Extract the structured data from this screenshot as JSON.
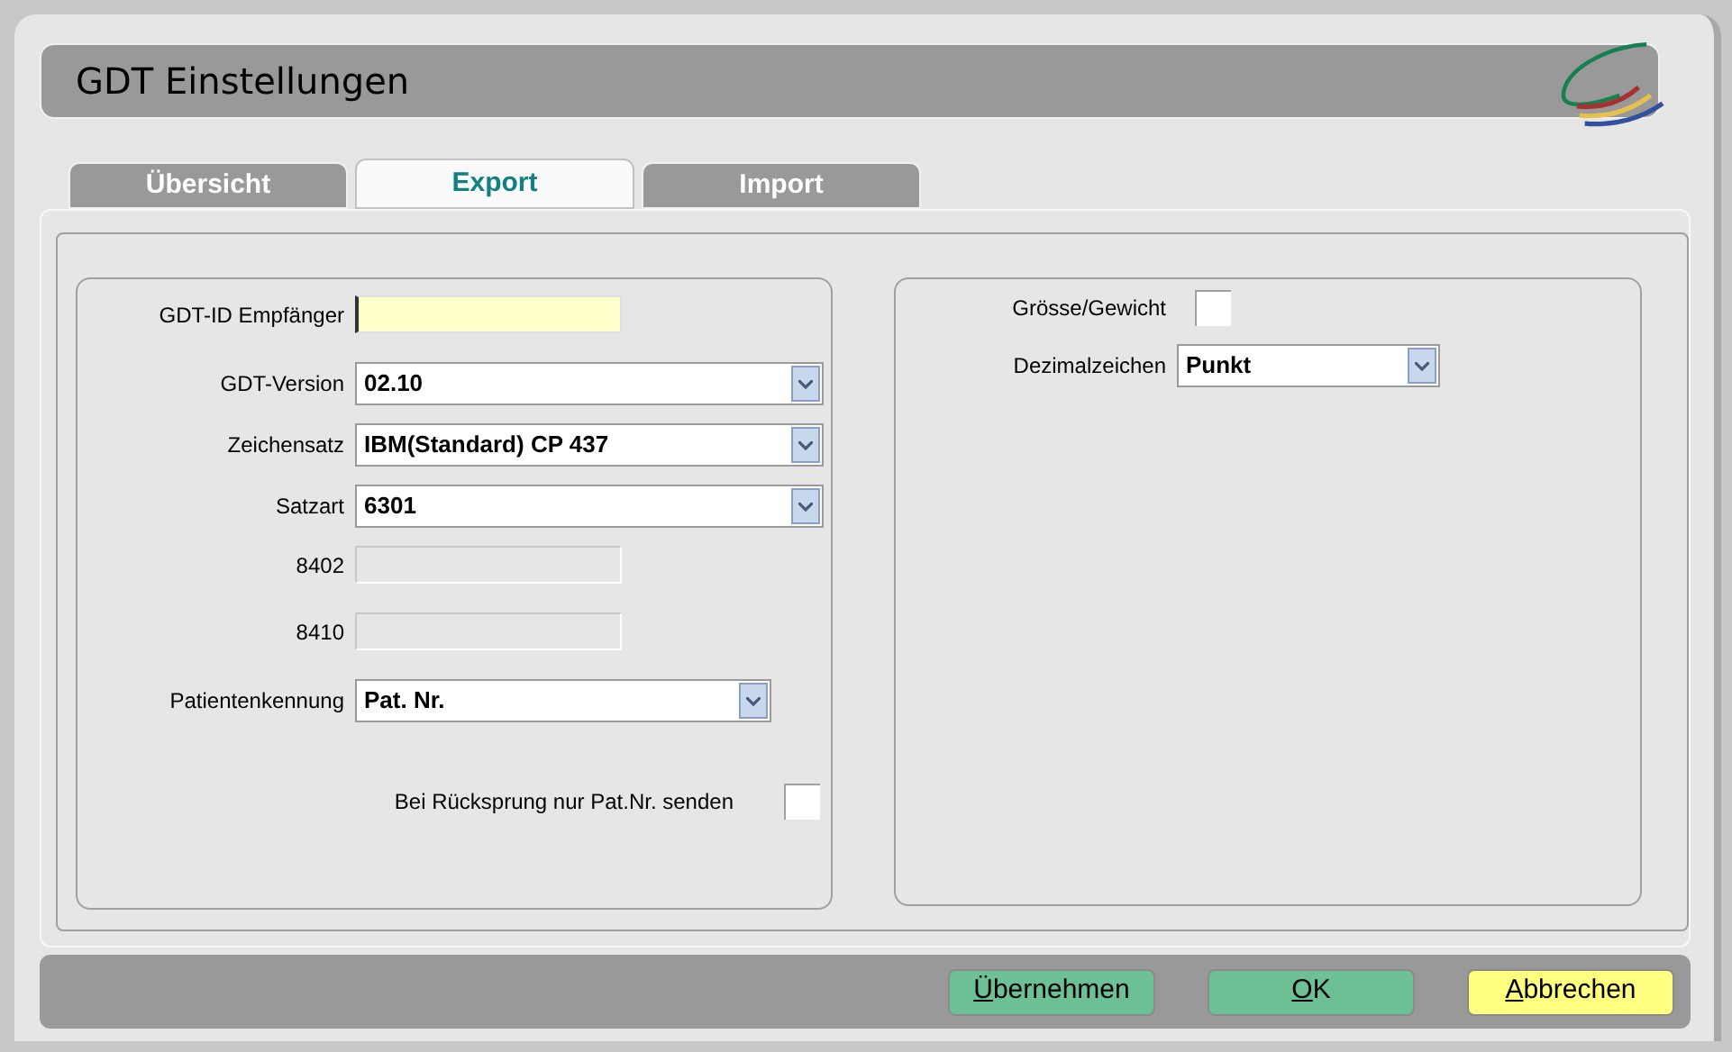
{
  "window": {
    "title": "GDT Einstellungen"
  },
  "tabs": [
    {
      "label": "Übersicht",
      "selected": false
    },
    {
      "label": "Export",
      "selected": true
    },
    {
      "label": "Import",
      "selected": false
    }
  ],
  "left_group": [
    {
      "kind": "text",
      "label": "GDT-ID Empfänger",
      "focused": true,
      "disabled": false
    },
    {
      "kind": "select",
      "label": "GDT-Version",
      "value": "02.10"
    },
    {
      "kind": "select",
      "label": "Zeichensatz",
      "value": "IBM(Standard) CP 437"
    },
    {
      "kind": "select",
      "label": "Satzart",
      "value": "6301"
    },
    {
      "kind": "text",
      "label": "8402",
      "focused": false,
      "disabled": true
    },
    {
      "kind": "text",
      "label": "8410",
      "focused": false,
      "disabled": true
    },
    {
      "kind": "select",
      "label": "Patientenkennung",
      "value": "Pat. Nr.",
      "narrow": true
    },
    {
      "kind": "checkbox",
      "label": "Bei Rücksprung nur Pat.Nr. senden",
      "checked": false
    }
  ],
  "right_group": [
    {
      "kind": "checkbox",
      "label": "Grösse/Gewicht",
      "checked": false
    },
    {
      "kind": "select",
      "label": "Dezimalzeichen",
      "value": "Punkt"
    }
  ],
  "buttons": [
    {
      "label": "Übernehmen",
      "color": "#6dbf96"
    },
    {
      "label": "OK",
      "color": "#6dbf96"
    },
    {
      "label": "Abbrechen",
      "color": "#ffff80"
    }
  ]
}
